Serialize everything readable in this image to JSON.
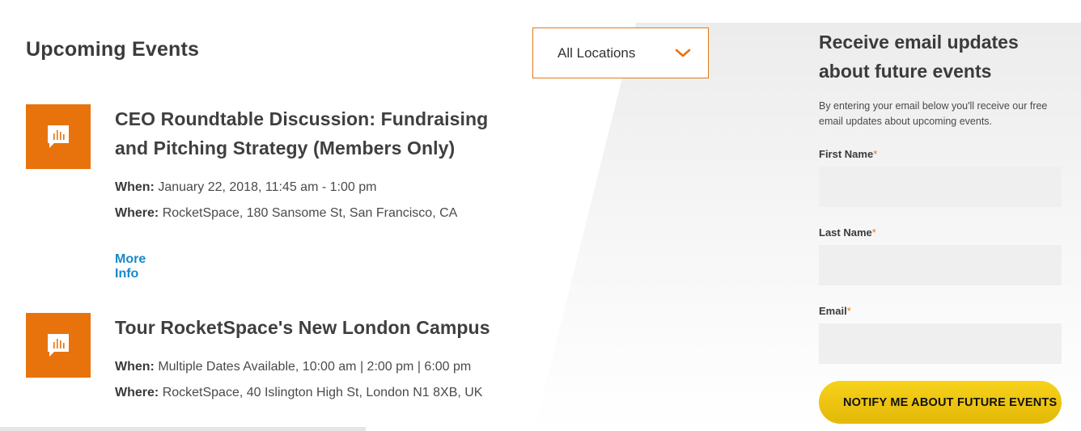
{
  "page": {
    "title": "Upcoming Events"
  },
  "location_filter": {
    "selected": "All Locations"
  },
  "events": [
    {
      "title": "CEO Roundtable Discussion: Fundraising and Pitching Strategy (Members Only)",
      "when_label": "When:",
      "when": "January 22, 2018, 11:45 am - 1:00 pm",
      "where_label": "Where:",
      "where": "RocketSpace, 180 Sansome St, San Francisco, CA",
      "more_info": "More Info"
    },
    {
      "title": "Tour RocketSpace's New London Campus",
      "when_label": "When:",
      "when": "Multiple Dates Available, 10:00 am | 2:00 pm | 6:00 pm",
      "where_label": "Where:",
      "where": "RocketSpace, 40 Islington High St, London N1 8XB, UK"
    }
  ],
  "signup": {
    "heading": "Receive email updates about future events",
    "description": "By entering your email below you'll receive our free email updates about upcoming events.",
    "first_name_label": "First Name",
    "last_name_label": "Last Name",
    "email_label": "Email",
    "required_mark": "*",
    "button_label": "NOTIFY ME ABOUT FUTURE EVENTS"
  },
  "colors": {
    "accent_orange": "#e8720c",
    "link_blue": "#1a88c9",
    "button_yellow": "#f2c811",
    "input_bg": "#efefef"
  },
  "icons": {
    "event_icon": "speech-bubble-chart-icon",
    "dropdown_icon": "chevron-down-icon"
  }
}
